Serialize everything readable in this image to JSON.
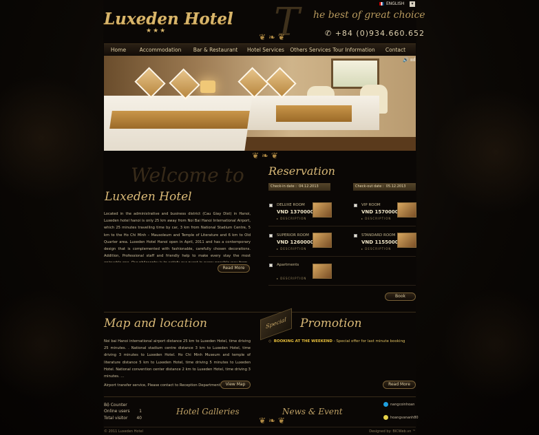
{
  "header": {
    "logo": "Luxeden Hotel",
    "stars": "★★★",
    "slogan_letter": "T",
    "slogan": "he best of great choice",
    "phone": "✆ +84 (0)934.660.652",
    "language": "ENGLISH"
  },
  "nav": [
    {
      "label": "Home"
    },
    {
      "label": "Accommodation"
    },
    {
      "label": "Bar & Restaurant"
    },
    {
      "label": "Hotel Services"
    },
    {
      "label": "Others Services"
    },
    {
      "label": "Tour Information"
    },
    {
      "label": "Contact"
    }
  ],
  "hero": {
    "volume_label": "🔊 ıııl"
  },
  "welcome": {
    "ghost": "Welcome to",
    "title": "Luxeden Hotel",
    "text": "Located in the administrative and business district (Cau Giay Dist) in Hanoi, Luxeden hotel hanoi is only 25 km away from Noi Bai Hanoi International Airport, which 25 minutes travelling time by car, 3 km from National Stadium Centre, 5 km to the Ho Chi Minh – Mausoleum and Temple of Literature and 6 km to Old Quarter area. Luxeden Hotel Hanoi open in April, 2011 and has a contemporary design that is complemented with fashionable, carefully chosen decorations. Addition, Professional staff and friendly help to make every stay the most enjoyable one. Our philosophy is to satisfy our guest in every possible way from",
    "read_more": "Read More"
  },
  "reservation": {
    "title": "Reservation",
    "checkin_label": "Check-in date",
    "checkin_value": "04.12.2013",
    "checkout_label": "Check-out date",
    "checkout_value": "05.12.2013",
    "rooms": [
      {
        "name": "DELUXE ROOM",
        "price": "VND 1370000",
        "desc": "▸ DESCRIPTION"
      },
      {
        "name": "VIP ROOM",
        "price": "VND 1570000",
        "desc": "▸ DESCRIPTION"
      },
      {
        "name": "SUPERIOR ROOM",
        "price": "VND 1260000",
        "desc": "▸ DESCRIPTION"
      },
      {
        "name": "STANDARD ROOM",
        "price": "VND 1155000",
        "desc": "▸ DESCRIPTION"
      },
      {
        "name": "Apartments",
        "price": "",
        "desc": "▸ DESCRIPTION"
      }
    ],
    "book": "Book"
  },
  "map": {
    "title": "Map and location",
    "text": "Noi bai Hanoi international airport distance 25 km to Luxeden Hotel, time driving 25 minutes. . National stadium centre distance 3 km to Luxeden Hotel, time driving 3 minutes to Luxeden Hotel. Ho Chi Minh Museum and temple of literature distance 5 km to Luxeden Hotel, time driving 5 minutes to Luxeden Hotel. National convention center distance 2 km to Luxeden Hotel, time driving 3 minutes. ...",
    "text2": "Airport transfer service, Please contact to Reception Department.",
    "view_map": "View Map"
  },
  "promotion": {
    "ribbon": "Special",
    "title": "Promotion",
    "item_bold": "BOOKING AT THE WEEKEND",
    "item_rest": " - Special offer for last minute booking",
    "read_more": "Read More"
  },
  "footer": {
    "counter_title": "Bộ Counter",
    "online_label": "Online users",
    "online_value": "1",
    "total_label": "Total visitor",
    "total_value": "40",
    "galleries": "Hotel Galleries",
    "news": "News & Event",
    "skype": "nangcoinhoan",
    "yahoo": "hoangvananh80",
    "copyright": "© 2011 Luxeden Hotel",
    "design": "Designed by: BICWeb.vn ™"
  },
  "colors": {
    "gold": "#d9b977",
    "background": "#0a0705"
  }
}
